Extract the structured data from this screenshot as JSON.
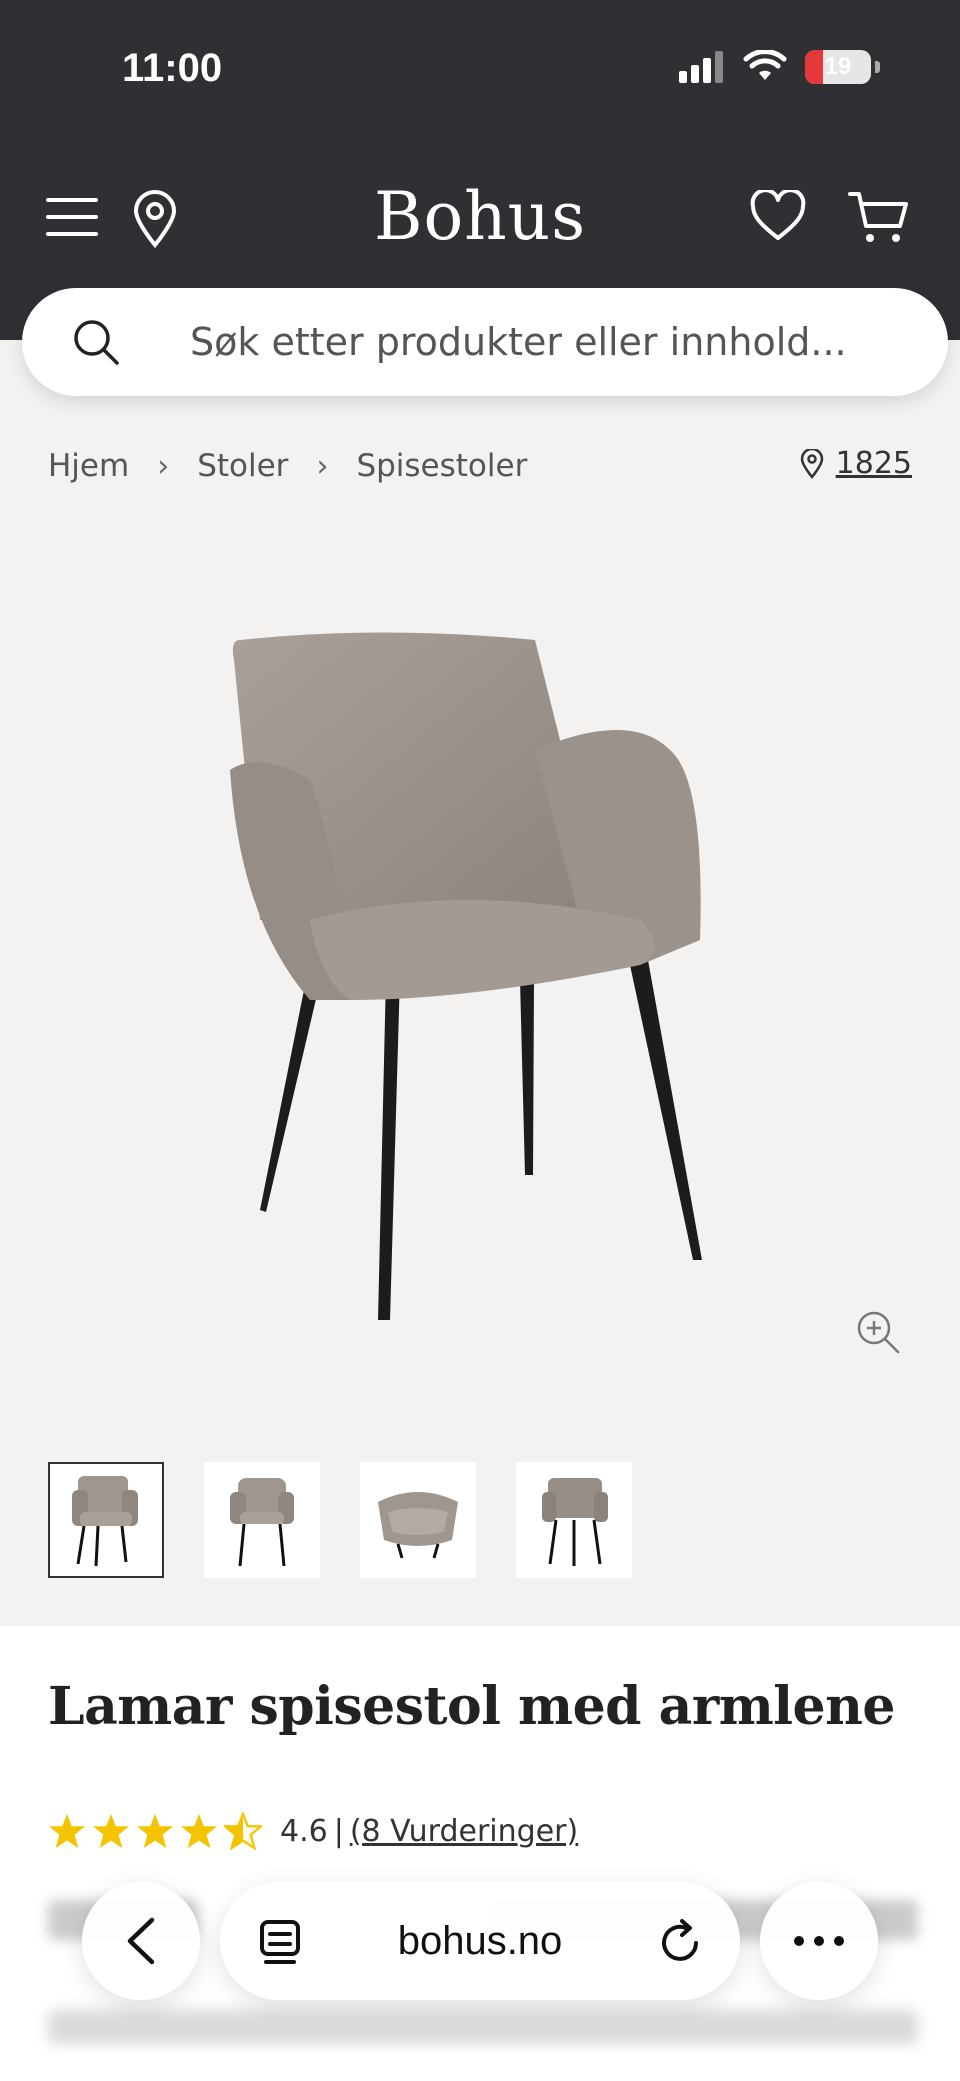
{
  "status": {
    "time": "11:00",
    "battery": "19"
  },
  "header": {
    "logo": "Bohus"
  },
  "search": {
    "placeholder": "Søk etter produkter eller innhold..."
  },
  "breadcrumb": {
    "items": [
      "Hjem",
      "Stoler",
      "Spisestoler"
    ],
    "store": "1825"
  },
  "product": {
    "title": "Lamar spisestol med armlene",
    "rating": "4.6",
    "rating_sep": "|",
    "reviews": "(8 Vurderinger)",
    "stars": 4.6
  },
  "browser": {
    "url": "bohus.no"
  },
  "colors": {
    "header_bg": "#2f2f34",
    "star": "#f5c400",
    "page_bg": "#f4f2f1"
  },
  "icons": [
    "menu-icon",
    "location-icon",
    "heart-icon",
    "cart-icon",
    "search-icon",
    "zoom-in-icon",
    "back-icon",
    "tabs-icon",
    "reload-icon",
    "more-icon"
  ]
}
